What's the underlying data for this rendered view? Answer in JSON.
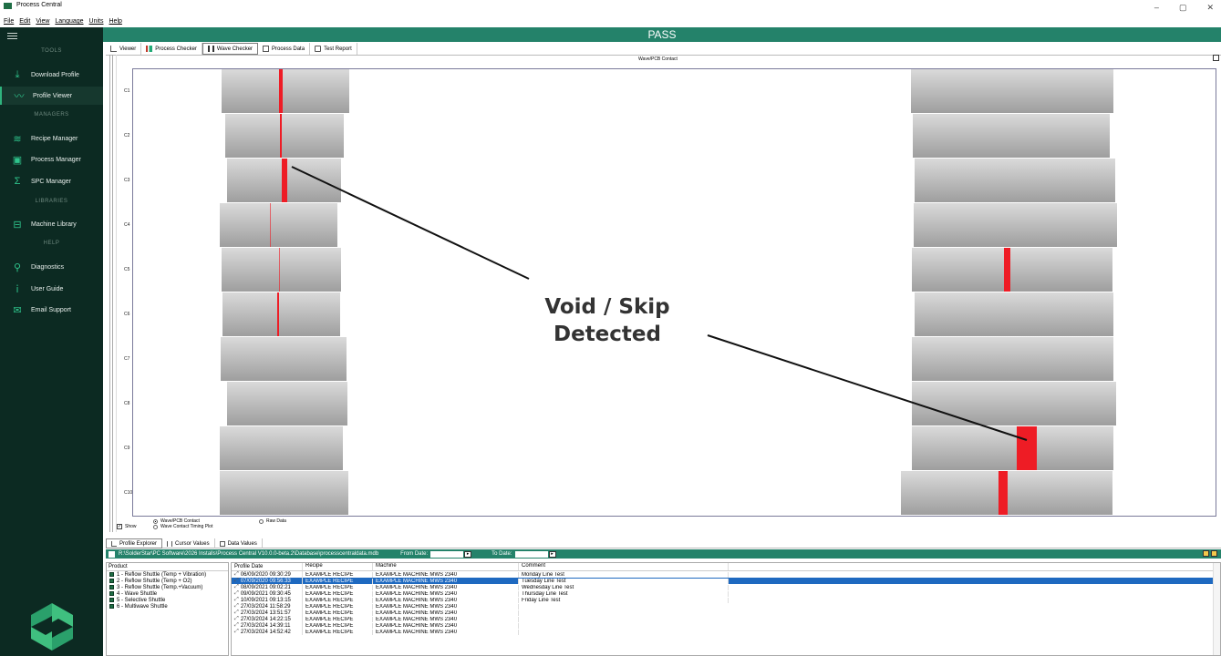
{
  "window": {
    "title": "Process Central",
    "controls": [
      "–",
      "▢",
      "✕"
    ],
    "menu": [
      "File",
      "Edit",
      "View",
      "Language",
      "Units",
      "Help"
    ]
  },
  "sidebar": {
    "sections": {
      "tools": "TOOLS",
      "managers": "MANAGERS",
      "libraries": "LIBRARIES",
      "help": "HELP"
    },
    "items": [
      {
        "label": "Download Profile",
        "icon": "download-icon"
      },
      {
        "label": "Profile Viewer",
        "icon": "profile-wave-icon"
      },
      {
        "label": "Recipe Manager",
        "icon": "recipe-sliders-icon"
      },
      {
        "label": "Process Manager",
        "icon": "process-icon"
      },
      {
        "label": "SPC Manager",
        "icon": "sigma-icon"
      },
      {
        "label": "Machine Library",
        "icon": "machine-icon"
      },
      {
        "label": "Diagnostics",
        "icon": "search-icon"
      },
      {
        "label": "User Guide",
        "icon": "info-icon"
      },
      {
        "label": "Email Support",
        "icon": "mail-icon"
      }
    ]
  },
  "status": {
    "text": "PASS",
    "color": "#24826a"
  },
  "tabs": [
    "Viewer",
    "Process Checker",
    "Wave Checker",
    "Process Data",
    "Test Report"
  ],
  "active_tab": "Wave Checker",
  "chart": {
    "title": "Wave/PCB Contact",
    "rows": [
      "C1",
      "C2",
      "C3",
      "C4",
      "C5",
      "C6",
      "C7",
      "C8",
      "C9",
      "C10"
    ],
    "annotation_line1": "Void / Skip",
    "annotation_line2": "Detected",
    "options": {
      "wave_pcb_contact": "Wave/PCB Contact",
      "wave_contact_timing": "Wave Contact Timing Plot",
      "raw_data": "Raw Data",
      "show": "Show"
    },
    "accent_red": "#ee1c25"
  },
  "bottom": {
    "tabs": [
      "Profile Explorer",
      "Cursor Values",
      "Data Values"
    ],
    "db_path": "R:\\SolderStar\\PC Software\\2026 Installs\\Process Central V10.0.0-beta.2\\Database\\processcentraldata.mdb",
    "from_label": "From Date:",
    "to_label": "To Date:",
    "product_header": "Product",
    "products": [
      "1 - Reflow Shuttle (Temp + Vibration)",
      "2 - Reflow Shuttle (Temp + O2)",
      "3 - Reflow Shuttle (Temp.+Vacuum)",
      "4 - Wave Shuttle",
      "5 - Selective Shuttle",
      "6 - Multiwave Shuttle"
    ],
    "columns": [
      "Profile Date",
      "Recipe",
      "Machine",
      "Comment"
    ],
    "rows": [
      {
        "date": "06/09/2020 09:30:29",
        "recipe": "EXAMPLE RECIPE",
        "machine": "EXAMPLE MACHINE MWS 2340",
        "comment": "Monday Line Test"
      },
      {
        "date": "07/09/2020 09:56:33",
        "recipe": "EXAMPLE RECIPE",
        "machine": "EXAMPLE MACHINE MWS 2340",
        "comment": "Tuesday Line Test"
      },
      {
        "date": "08/09/2021 09:02:21",
        "recipe": "EXAMPLE RECIPE",
        "machine": "EXAMPLE MACHINE MWS 2340",
        "comment": "Wednesday Line Test"
      },
      {
        "date": "09/09/2021 09:30:45",
        "recipe": "EXAMPLE RECIPE",
        "machine": "EXAMPLE MACHINE MWS 2340",
        "comment": "Thursday Line Test"
      },
      {
        "date": "10/09/2021 09:13:15",
        "recipe": "EXAMPLE RECIPE",
        "machine": "EXAMPLE MACHINE MWS 2340",
        "comment": "Friday Line Test"
      },
      {
        "date": "27/03/2024 11:58:29",
        "recipe": "EXAMPLE RECIPE",
        "machine": "EXAMPLE MACHINE MWS 2340",
        "comment": ""
      },
      {
        "date": "27/03/2024 13:51:57",
        "recipe": "EXAMPLE RECIPE",
        "machine": "EXAMPLE MACHINE MWS 2340",
        "comment": ""
      },
      {
        "date": "27/03/2024 14:22:15",
        "recipe": "EXAMPLE RECIPE",
        "machine": "EXAMPLE MACHINE MWS 2340",
        "comment": ""
      },
      {
        "date": "27/03/2024 14:39:11",
        "recipe": "EXAMPLE RECIPE",
        "machine": "EXAMPLE MACHINE MWS 2340",
        "comment": ""
      },
      {
        "date": "27/03/2024 14:52:42",
        "recipe": "EXAMPLE RECIPE",
        "machine": "EXAMPLE MACHINE MWS 2340",
        "comment": ""
      }
    ],
    "selected_row": 1
  }
}
